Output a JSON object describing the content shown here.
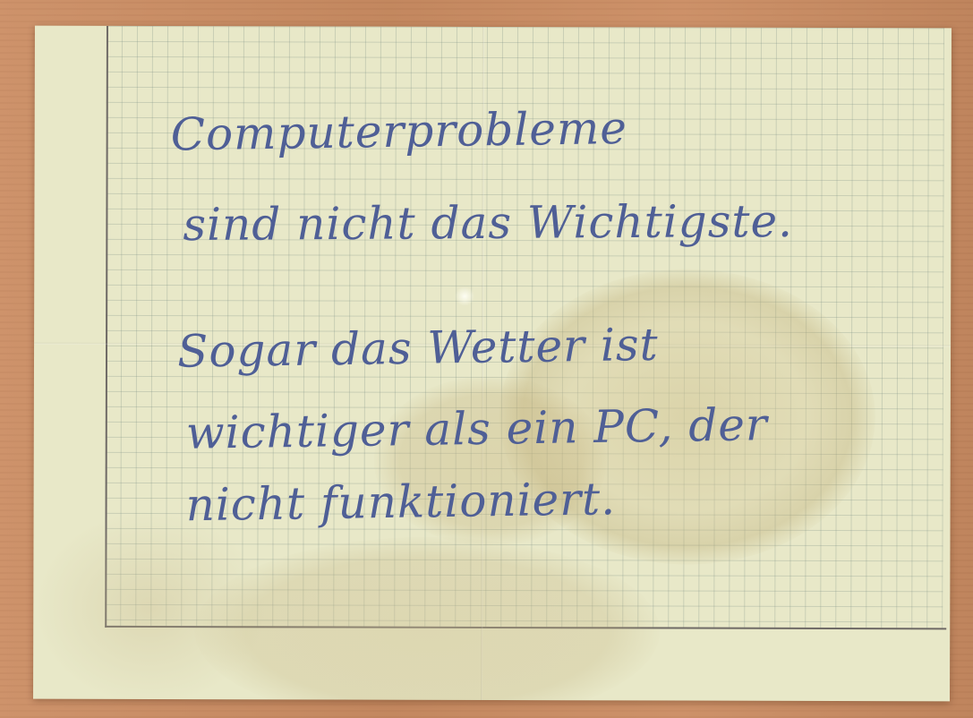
{
  "note": {
    "lines": [
      "Computerprobleme",
      "sind nicht das Wichtigste.",
      "Sogar das Wetter ist",
      "wichtiger als ein PC, der",
      "nicht funktioniert."
    ]
  },
  "colors": {
    "paper": "#e8e8c8",
    "ink": "#4f5f96",
    "table": "#cb8d63",
    "margin_line": "#6f6a66"
  }
}
